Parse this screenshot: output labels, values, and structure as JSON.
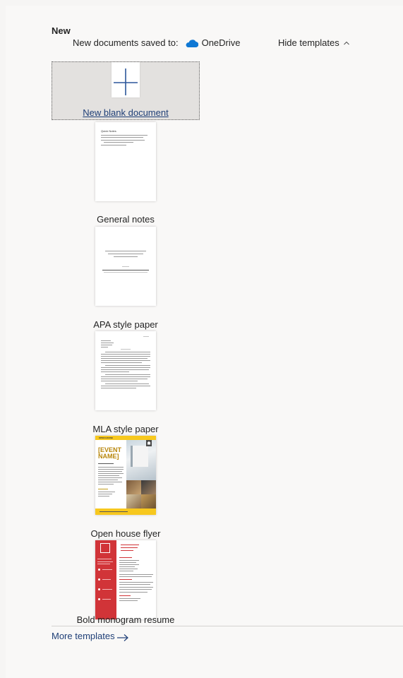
{
  "section": {
    "heading": "New",
    "saved_to_text": "New documents saved to:",
    "storage_name": "OneDrive",
    "hide_templates_label": "Hide templates"
  },
  "blank": {
    "label": "New blank document"
  },
  "templates": [
    {
      "label": "General notes",
      "preview_title": "Quick Notes"
    },
    {
      "label": "APA style paper"
    },
    {
      "label": "MLA style paper"
    },
    {
      "label": "Open house flyer",
      "preview_header": "OPEN HOUSE",
      "preview_event": "[EVENT NAME]"
    },
    {
      "label": "Bold monogram resume"
    }
  ],
  "footer": {
    "more_templates_label": "More templates"
  },
  "colors": {
    "link": "#1f3f77",
    "onedrive": "#0f78d4",
    "flyer_yellow": "#f7c81e",
    "resume_red": "#d13438"
  }
}
